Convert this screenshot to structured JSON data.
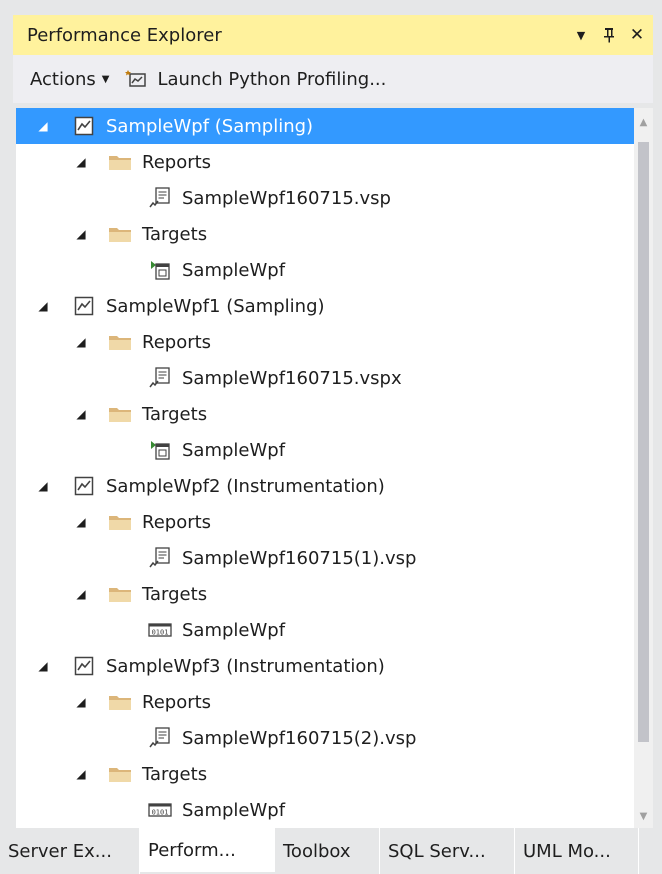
{
  "window": {
    "title": "Performance Explorer",
    "menu_glyph": "▼",
    "pin_glyph": "ᚘ",
    "close_glyph": "✕"
  },
  "toolbar": {
    "actions_label": "Actions",
    "launch_label": "Launch Python Profiling..."
  },
  "tree": [
    {
      "level": 0,
      "icon": "session-icon",
      "label": "SampleWpf (Sampling)",
      "selected": true
    },
    {
      "level": 1,
      "icon": "folder-icon",
      "label": "Reports"
    },
    {
      "level": 2,
      "icon": "report-file-icon",
      "label": "SampleWpf160715.vsp"
    },
    {
      "level": 1,
      "icon": "folder-icon",
      "label": "Targets"
    },
    {
      "level": 2,
      "icon": "launch-target-icon",
      "label": "SampleWpf"
    },
    {
      "level": 0,
      "icon": "session-icon",
      "label": "SampleWpf1 (Sampling)"
    },
    {
      "level": 1,
      "icon": "folder-icon",
      "label": "Reports"
    },
    {
      "level": 2,
      "icon": "report-file-icon",
      "label": "SampleWpf160715.vspx"
    },
    {
      "level": 1,
      "icon": "folder-icon",
      "label": "Targets"
    },
    {
      "level": 2,
      "icon": "launch-target-icon",
      "label": "SampleWpf"
    },
    {
      "level": 0,
      "icon": "session-icon",
      "label": "SampleWpf2 (Instrumentation)"
    },
    {
      "level": 1,
      "icon": "folder-icon",
      "label": "Reports"
    },
    {
      "level": 2,
      "icon": "report-file-icon",
      "label": "SampleWpf160715(1).vsp"
    },
    {
      "level": 1,
      "icon": "folder-icon",
      "label": "Targets"
    },
    {
      "level": 2,
      "icon": "binary-target-icon",
      "label": "SampleWpf"
    },
    {
      "level": 0,
      "icon": "session-icon",
      "label": "SampleWpf3 (Instrumentation)"
    },
    {
      "level": 1,
      "icon": "folder-icon",
      "label": "Reports"
    },
    {
      "level": 2,
      "icon": "report-file-icon",
      "label": "SampleWpf160715(2).vsp"
    },
    {
      "level": 1,
      "icon": "folder-icon",
      "label": "Targets"
    },
    {
      "level": 2,
      "icon": "binary-target-icon",
      "label": "SampleWpf"
    }
  ],
  "tabs": [
    {
      "label": "Server Ex...",
      "active": false
    },
    {
      "label": "Perform...",
      "active": true
    },
    {
      "label": "Toolbox",
      "active": false
    },
    {
      "label": "SQL Serv...",
      "active": false
    },
    {
      "label": "UML Mo...",
      "active": false
    }
  ],
  "colors": {
    "title_bar": "#fff29d",
    "selection": "#3399ff",
    "folder": "#dcb67a"
  }
}
